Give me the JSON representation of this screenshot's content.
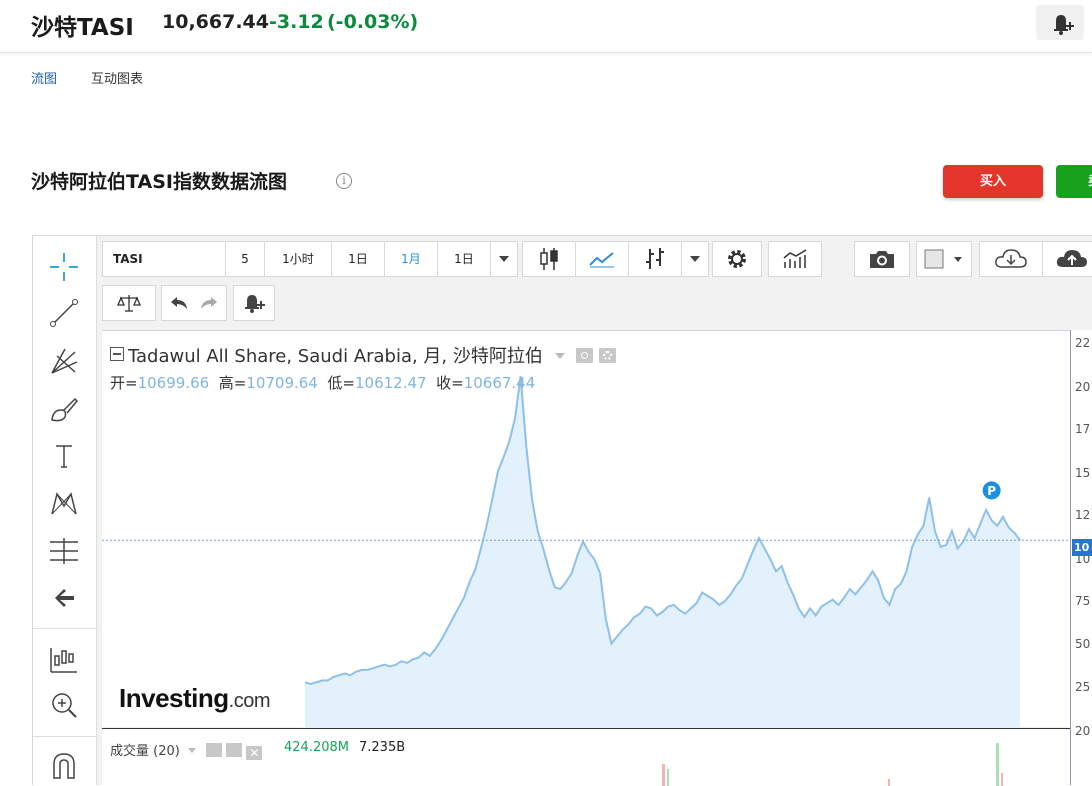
{
  "header": {
    "name": "沙特TASI",
    "price": "10,667.44",
    "change": "-3.12",
    "change_pct": "(-0.03%)"
  },
  "nav": {
    "flow": "流图",
    "interactive": "互动图表"
  },
  "section_title": "沙特阿拉伯TASI指数数据流图",
  "info_icon_text": "i",
  "buttons": {
    "buy": "买入",
    "sell": "卖"
  },
  "toolbar": {
    "symbol": "TASI",
    "interval_5": "5",
    "interval_1h": "1小时",
    "interval_1d": "1日",
    "interval_1m": "1月",
    "range": "1日"
  },
  "legend": {
    "title": "Tadawul All Share, Saudi Arabia, 月, 沙特阿拉伯",
    "open_label": "开=",
    "open": "10699.66",
    "high_label": "高=",
    "high": "10709.64",
    "low_label": "低=",
    "low": "10612.47",
    "close_label": "收=",
    "close": "10667.44"
  },
  "y_ticks": [
    "22",
    "20",
    "17",
    "15",
    "12",
    "10",
    "75",
    "50",
    "25",
    "20"
  ],
  "price_tag": "10",
  "marker": "P",
  "volume": {
    "label": "成交量 (20)",
    "value1": "424.208M",
    "value2": "7.235B"
  },
  "brand": {
    "main": "Investing",
    "suffix": ".com"
  },
  "colors": {
    "up": "#0a8a3a",
    "buy": "#e4352a",
    "sell": "#19a11e",
    "line": "#8fc0e8",
    "fill": "#e2f1fb"
  },
  "chart_data": {
    "type": "area",
    "series": [
      {
        "values": [
          2.6,
          2.5,
          2.6,
          2.7,
          2.7,
          2.9,
          3.0,
          3.1,
          3.0,
          3.2,
          3.3,
          3.3,
          3.4,
          3.5,
          3.6,
          3.5,
          3.6,
          3.8,
          3.7,
          3.9,
          4.0,
          4.3,
          4.1,
          4.5,
          5.0,
          5.6,
          6.2,
          6.8,
          7.4,
          8.3,
          9.0,
          10.2,
          11.5,
          13.0,
          14.6,
          15.4,
          16.3,
          17.6,
          20.0,
          16.0,
          13.0,
          11.2,
          10.2,
          9.0,
          8.0,
          7.9,
          8.3,
          8.8,
          9.8,
          10.6,
          10.0,
          9.6,
          8.8,
          6.2,
          4.8,
          5.2,
          5.6,
          5.9,
          6.3,
          6.5,
          6.9,
          6.8,
          6.4,
          6.6,
          6.9,
          7.0,
          6.7,
          6.5,
          6.8,
          7.1,
          7.7,
          7.5,
          7.3,
          7.0,
          7.2,
          7.6,
          8.1,
          8.5,
          9.3,
          10.1,
          10.8,
          10.2,
          9.6,
          8.9,
          9.2,
          8.3,
          7.6,
          6.8,
          6.3,
          6.8,
          6.4,
          6.9,
          7.1,
          7.3,
          7.0,
          7.4,
          7.9,
          7.6,
          8.0,
          8.4,
          8.9,
          8.4,
          7.4,
          7.0,
          7.9,
          8.2,
          8.9,
          10.3,
          11.0,
          11.5,
          13.1,
          11.2,
          10.3,
          10.4,
          11.2,
          10.2,
          10.6,
          11.3,
          10.8,
          11.6,
          12.4,
          11.8,
          11.5,
          12.0,
          11.4,
          11.1,
          10.67
        ]
      }
    ]
  }
}
